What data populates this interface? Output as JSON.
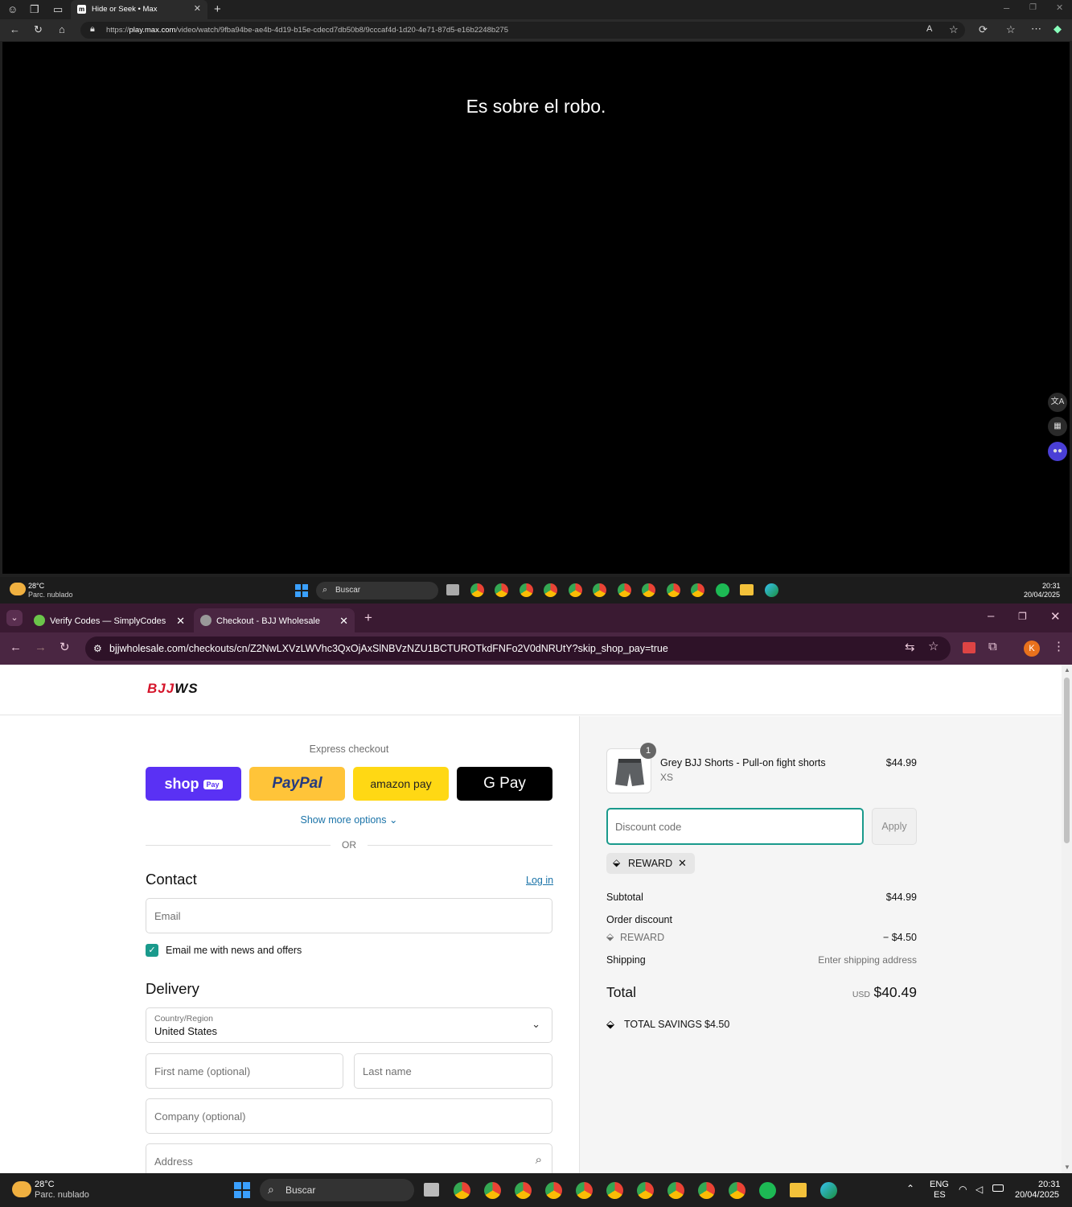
{
  "top_browser": {
    "tab_title": "Hide or Seek • Max",
    "url_prefix": "https://",
    "url_domain": "play.max.com",
    "url_path": "/video/watch/9fba94be-ae4b-4d19-b15e-cdecd7db50b8/9cccaf4d-1d20-4e71-87d5-e16b2248b275",
    "subtitle": "Es sobre el robo."
  },
  "taskbar_top": {
    "weather_temp": "28°C",
    "weather_desc": "Parc. nublado",
    "search_label": "Buscar",
    "time": "20:31",
    "date": "20/04/2025"
  },
  "chrome": {
    "tabs": [
      {
        "label": "Verify Codes — SimplyCodes"
      },
      {
        "label": "Checkout - BJJ Wholesale"
      }
    ],
    "url": "bjjwholesale.com/checkouts/cn/Z2NwLXVzLWVhc3QxOjAxSlNBVzNZU1BCTUROTkdFNFo2V0dNRUtY?skip_shop_pay=true",
    "profile_initial": "K"
  },
  "checkout": {
    "logo_red": "BJJ",
    "logo_black": "WS",
    "express_title": "Express checkout",
    "shop_pay": "shop",
    "shop_pay_badge": "Pay",
    "paypal": "PayPal",
    "amazon_pay": "amazon pay",
    "google_pay": "G Pay",
    "show_more": "Show more options",
    "or": "OR",
    "contact_heading": "Contact",
    "login_link": "Log in",
    "email_placeholder": "Email",
    "newsletter_label": "Email me with news and offers",
    "newsletter_checked": true,
    "delivery_heading": "Delivery",
    "country_label": "Country/Region",
    "country_value": "United States",
    "first_name_placeholder": "First name (optional)",
    "last_name_placeholder": "Last name",
    "company_placeholder": "Company (optional)",
    "address_placeholder": "Address"
  },
  "summary": {
    "product_qty": "1",
    "product_name": "Grey BJJ Shorts - Pull-on fight shorts",
    "product_variant": "XS",
    "product_price": "$44.99",
    "discount_placeholder": "Discount code",
    "apply_label": "Apply",
    "applied_code": "REWARD",
    "subtotal_label": "Subtotal",
    "subtotal_value": "$44.99",
    "order_discount_label": "Order discount",
    "discount_code": "REWARD",
    "discount_value": "− $4.50",
    "shipping_label": "Shipping",
    "shipping_value": "Enter shipping address",
    "total_label": "Total",
    "currency": "USD",
    "total_value": "$40.49",
    "savings_label": "TOTAL SAVINGS",
    "savings_value": "$4.50"
  },
  "taskbar_bottom": {
    "weather_temp": "28°C",
    "weather_desc": "Parc. nublado",
    "search_label": "Buscar",
    "lang_top": "ENG",
    "lang_bottom": "ES",
    "time": "20:31",
    "date": "20/04/2025"
  },
  "colors": {
    "accent_teal": "#1a9a8c",
    "link_blue": "#1a73a8",
    "shop_pay_purple": "#5a31f4",
    "paypal_yellow": "#ffc439",
    "amazon_yellow": "#ffd814",
    "chrome_frame": "#4a2642"
  }
}
